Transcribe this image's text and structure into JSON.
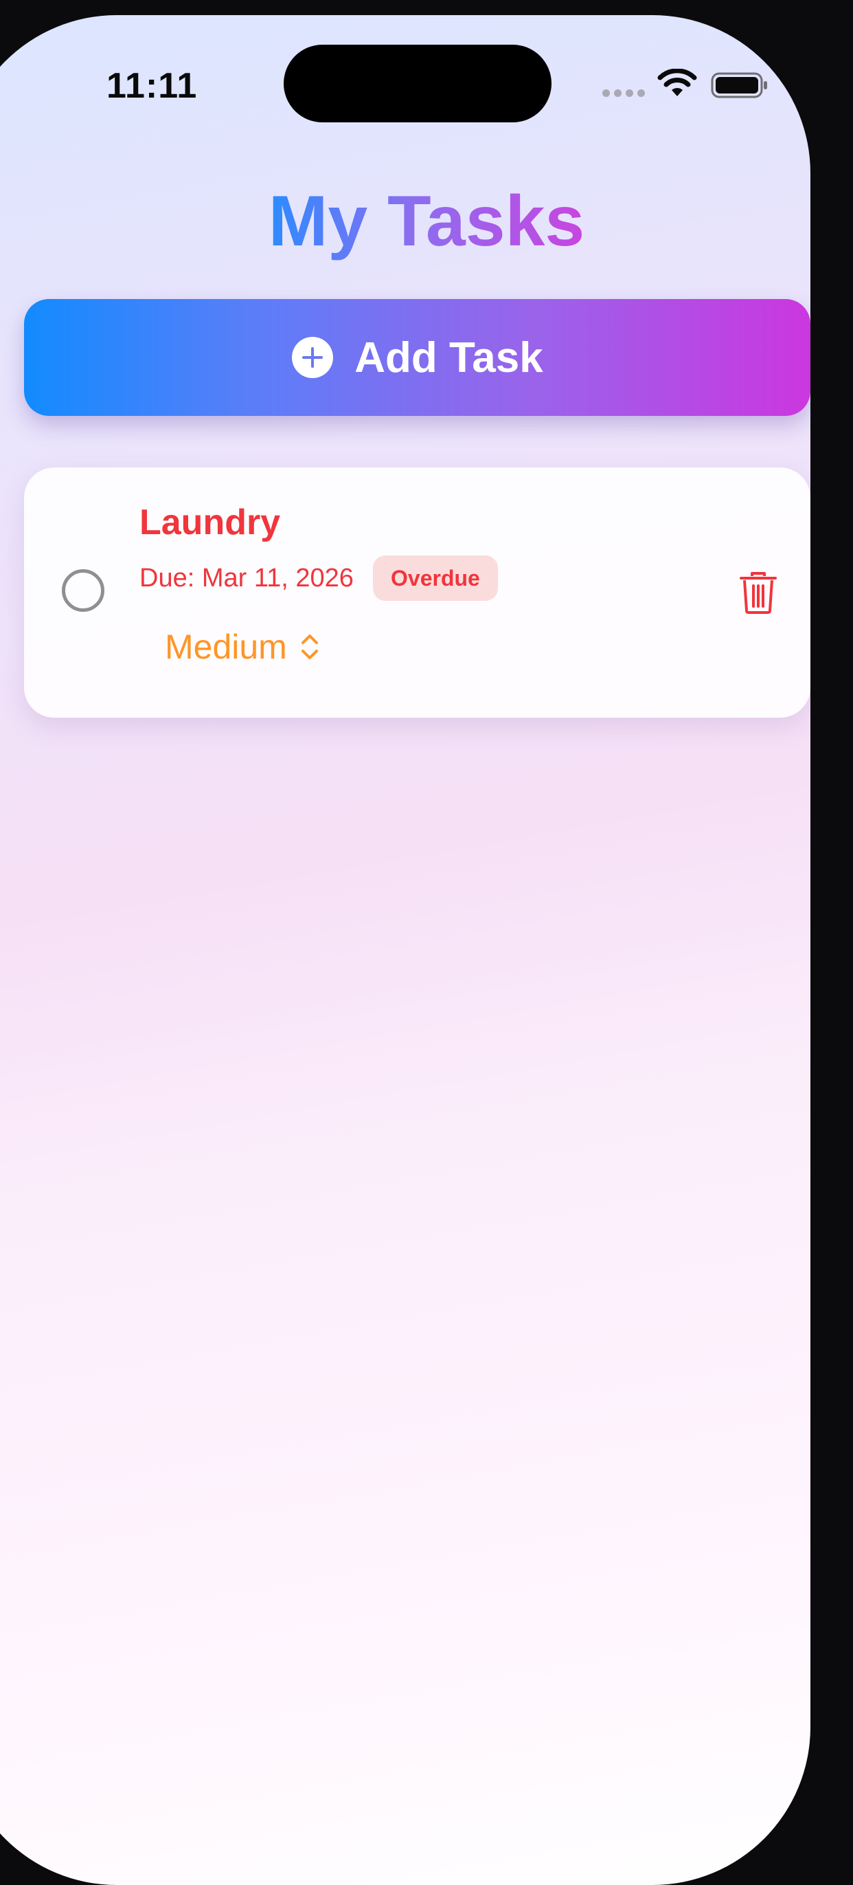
{
  "status_bar": {
    "time": "11:11"
  },
  "header": {
    "title": "My Tasks"
  },
  "add_button": {
    "label": "Add Task"
  },
  "tasks": [
    {
      "title": "Laundry",
      "due": "Due: Mar 11, 2026",
      "status_badge": "Overdue",
      "priority": "Medium",
      "completed": false
    }
  ],
  "colors": {
    "accent_blue": "#128bff",
    "accent_purple": "#cb37df",
    "overdue_red": "#f0353c",
    "priority_orange": "#ff9526"
  },
  "icons": {
    "add": "plus-circle-icon",
    "delete": "trash-icon",
    "priority_picker": "chevron-up-down-icon",
    "complete": "circle-checkbox-icon"
  }
}
